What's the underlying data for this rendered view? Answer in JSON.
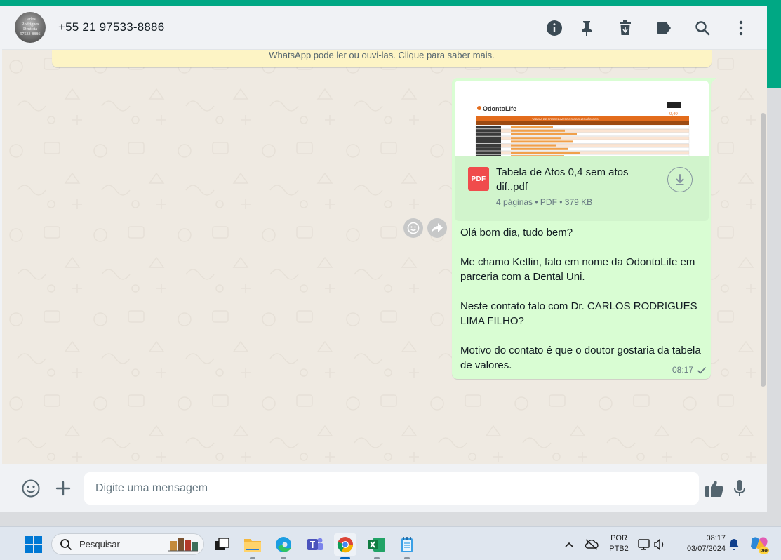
{
  "header": {
    "contact_name": "+55 21 97533-8886",
    "avatar_text": "Carlos Rodrigues Dentista 97533-8886",
    "icons": [
      "info-icon",
      "pin-icon",
      "trash-icon",
      "label-icon",
      "search-icon",
      "more-options-icon"
    ]
  },
  "chat": {
    "encryption_notice": "WhatsApp pode ler ou ouvi-las. Clique para saber mais.",
    "message": {
      "document": {
        "preview_brand": "OdontoLife",
        "preview_table_title": "TABELA DE PROCEDIMENTOS ODONTOLÓGICOS",
        "preview_value": "0,40",
        "icon_label": "PDF",
        "file_name": "Tabela de Atos 0,4 sem atos dif..pdf",
        "info": "4 páginas • PDF • 379 KB"
      },
      "paragraphs": [
        "Olá bom dia, tudo bem?",
        "Me chamo Ketlin, falo em nome da OdontoLife em parceria com a Dental Uni.",
        "Neste contato falo com Dr. CARLOS RODRIGUES LIMA FILHO?",
        "Motivo do contato é que o doutor gostaria da tabela de valores."
      ],
      "time": "08:17",
      "status": "sent"
    }
  },
  "composer": {
    "placeholder": "Digite uma mensagem"
  },
  "taskbar": {
    "search_label": "Pesquisar",
    "language_top": "POR",
    "language_bottom": "PTB2",
    "clock_time": "08:17",
    "clock_date": "03/07/2024",
    "copilot_badge": "PRE"
  },
  "colors": {
    "accent": "#00a884",
    "bubble_out": "#d9fdd3",
    "notice_bg": "#fdf4c5",
    "chat_bg": "#efeae2",
    "pdf_red": "#f04c4c"
  }
}
